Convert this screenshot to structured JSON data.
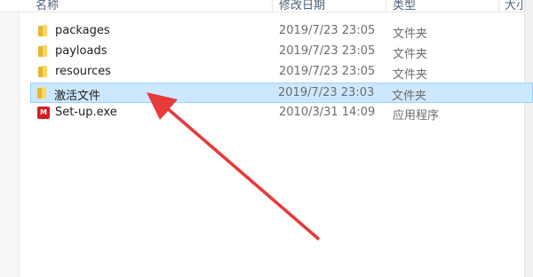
{
  "columns": {
    "name": "名称",
    "date": "修改日期",
    "type": "类型",
    "size": "大小"
  },
  "files": [
    {
      "name": "packages",
      "date": "2019/7/23 23:05",
      "type": "文件夹",
      "icon": "folder-icon",
      "selected": false
    },
    {
      "name": "payloads",
      "date": "2019/7/23 23:05",
      "type": "文件夹",
      "icon": "folder-icon",
      "selected": false
    },
    {
      "name": "resources",
      "date": "2019/7/23 23:05",
      "type": "文件夹",
      "icon": "folder-icon",
      "selected": false
    },
    {
      "name": "激活文件",
      "date": "2019/7/23 23:03",
      "type": "文件夹",
      "icon": "folder-icon",
      "selected": true
    },
    {
      "name": "Set-up.exe",
      "date": "2010/3/31 14:09",
      "type": "应用程序",
      "icon": "adobe-app-icon",
      "selected": false
    }
  ],
  "icon_badge": "M",
  "colors": {
    "selection": "#cce8ff",
    "arrow": "#e8393b",
    "folder": "#ffd766"
  }
}
